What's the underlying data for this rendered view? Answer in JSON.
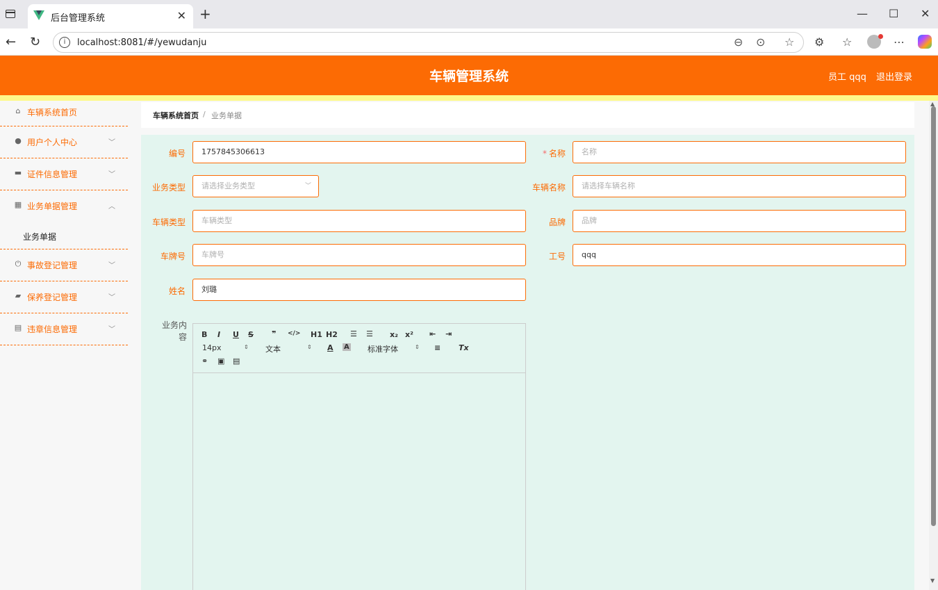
{
  "browser": {
    "tab_title": "后台管理系统",
    "url": "localhost:8081/#/yewudanju"
  },
  "header": {
    "title": "车辆管理系统",
    "user": "员工 qqq",
    "logout": "退出登录"
  },
  "sidebar": {
    "items": [
      {
        "label": "车辆系统首页",
        "icon": "home-icon"
      },
      {
        "label": "用户个人中心",
        "icon": "user-icon"
      },
      {
        "label": "证件信息管理",
        "icon": "monitor-icon"
      },
      {
        "label": "业务单据管理",
        "icon": "grid-icon"
      },
      {
        "label": "事故登记管理",
        "icon": "power-icon"
      },
      {
        "label": "保养登记管理",
        "icon": "ticket-icon"
      },
      {
        "label": "违章信息管理",
        "icon": "clipboard-icon"
      }
    ],
    "sub_item": "业务单据"
  },
  "breadcrumb": {
    "home": "车辆系统首页",
    "separator": "/",
    "current": "业务单据"
  },
  "form": {
    "bianhao_label": "编号",
    "bianhao_value": "1757845306613",
    "mingcheng_label": "名称",
    "mingcheng_required": "*",
    "mingcheng_placeholder": "名称",
    "yewuleixing_label": "业务类型",
    "yewuleixing_placeholder": "请选择业务类型",
    "cheliangmingcheng_label": "车辆名称",
    "cheliangmingcheng_placeholder": "请选择车辆名称",
    "cheliangleixing_label": "车辆类型",
    "cheliangleixing_placeholder": "车辆类型",
    "pinpai_label": "品牌",
    "pinpai_placeholder": "品牌",
    "chepaihao_label": "车牌号",
    "chepaihao_placeholder": "车牌号",
    "gonghao_label": "工号",
    "gonghao_value": "qqq",
    "xingming_label": "姓名",
    "xingming_value": "刘璐",
    "content_label": "业务内容"
  },
  "editor": {
    "font_size": "14px",
    "text_style": "文本",
    "font_family": "标准字体",
    "h1": "H1",
    "h2": "H2"
  },
  "colors": {
    "primary": "#fc6b04",
    "stripe": "#fef98a",
    "panel": "#e3f5ef"
  }
}
